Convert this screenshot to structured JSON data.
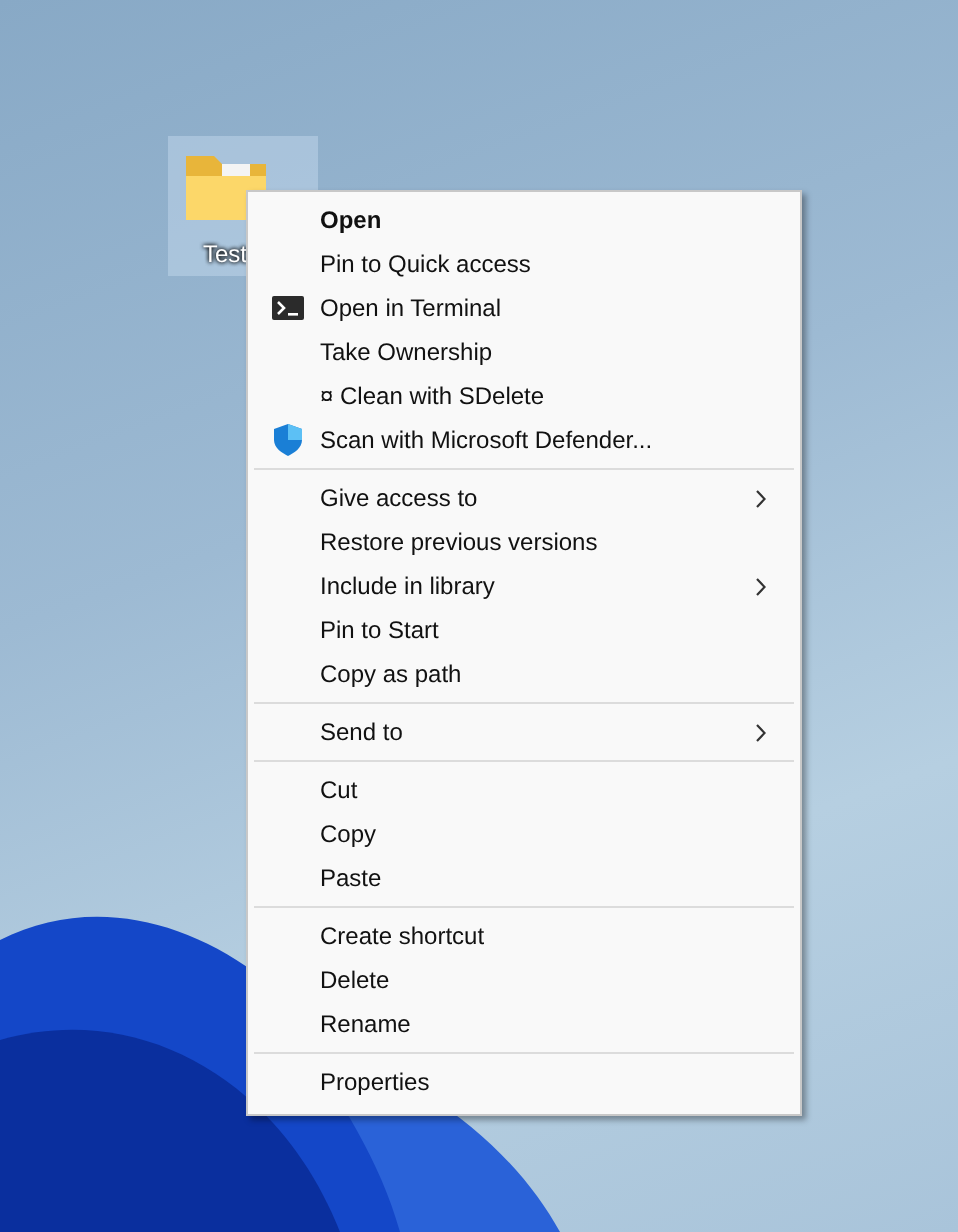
{
  "desktop": {
    "icon_label": "Test",
    "selected": true
  },
  "context_menu": {
    "groups": [
      {
        "items": [
          {
            "label": "Open",
            "default": true,
            "kind": "plain",
            "submenu": false
          },
          {
            "label": "Pin to Quick access",
            "default": false,
            "kind": "plain",
            "submenu": false
          },
          {
            "label": "Open in Terminal",
            "default": false,
            "kind": "terminal",
            "submenu": false
          },
          {
            "label": "Take Ownership",
            "default": false,
            "kind": "plain",
            "submenu": false
          },
          {
            "label": "¤ Clean with SDelete",
            "default": false,
            "kind": "plain",
            "submenu": false
          },
          {
            "label": "Scan with Microsoft Defender...",
            "default": false,
            "kind": "shield",
            "submenu": false
          }
        ]
      },
      {
        "items": [
          {
            "label": "Give access to",
            "default": false,
            "kind": "plain",
            "submenu": true
          },
          {
            "label": "Restore previous versions",
            "default": false,
            "kind": "plain",
            "submenu": false
          },
          {
            "label": "Include in library",
            "default": false,
            "kind": "plain",
            "submenu": true
          },
          {
            "label": "Pin to Start",
            "default": false,
            "kind": "plain",
            "submenu": false
          },
          {
            "label": "Copy as path",
            "default": false,
            "kind": "plain",
            "submenu": false
          }
        ]
      },
      {
        "items": [
          {
            "label": "Send to",
            "default": false,
            "kind": "plain",
            "submenu": true
          }
        ]
      },
      {
        "items": [
          {
            "label": "Cut",
            "default": false,
            "kind": "plain",
            "submenu": false
          },
          {
            "label": "Copy",
            "default": false,
            "kind": "plain",
            "submenu": false
          },
          {
            "label": "Paste",
            "default": false,
            "kind": "plain",
            "submenu": false
          }
        ]
      },
      {
        "items": [
          {
            "label": "Create shortcut",
            "default": false,
            "kind": "plain",
            "submenu": false
          },
          {
            "label": "Delete",
            "default": false,
            "kind": "plain",
            "submenu": false
          },
          {
            "label": "Rename",
            "default": false,
            "kind": "plain",
            "submenu": false
          }
        ]
      },
      {
        "items": [
          {
            "label": "Properties",
            "default": false,
            "kind": "plain",
            "submenu": false
          }
        ]
      }
    ]
  }
}
